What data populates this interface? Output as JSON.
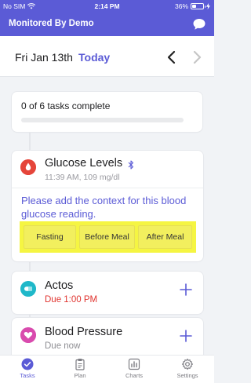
{
  "status_bar": {
    "carrier": "No SIM",
    "time": "2:14 PM",
    "battery_percent": "36%",
    "battery_level": 0.36,
    "wifi_icon": "wifi-icon",
    "charging_icon": "bolt-icon"
  },
  "header": {
    "title": "Monitored By Demo",
    "chat_icon": "chat-bubble-icon"
  },
  "date_bar": {
    "date": "Fri Jan 13th",
    "today_label": "Today",
    "prev_icon": "chevron-left-icon",
    "next_icon": "chevron-right-icon"
  },
  "progress": {
    "completed": "0",
    "of_label": "of",
    "total_label": "6 tasks complete",
    "fraction": 0.0
  },
  "tasks": [
    {
      "title": "Glucose Levels",
      "icon": "drop-icon",
      "badge_icon": "bluetooth-icon",
      "subtitle": "11:39 AM, 109 mg/dl",
      "message": "Please add the context for this blood glucose reading.",
      "context_options": [
        "Fasting",
        "Before Meal",
        "After Meal"
      ]
    },
    {
      "title": "Actos",
      "icon": "pill-icon",
      "status": "Due 1:00 PM",
      "status_color": "#e0332e",
      "action_icon": "plus-icon"
    },
    {
      "title": "Blood Pressure",
      "icon": "heart-icon",
      "status": "Due now",
      "status_color": "#8e8e93",
      "action_icon": "plus-icon"
    }
  ],
  "tab_bar": {
    "tabs": [
      {
        "label": "Tasks",
        "icon": "check-circle-icon",
        "active": true
      },
      {
        "label": "Plan",
        "icon": "clipboard-icon",
        "active": false
      },
      {
        "label": "Charts",
        "icon": "bar-chart-icon",
        "active": false
      },
      {
        "label": "Settings",
        "icon": "gear-icon",
        "active": false
      }
    ]
  },
  "colors": {
    "brand": "#5b5bd6",
    "highlight": "#f5f542",
    "due_red": "#e0332e"
  }
}
